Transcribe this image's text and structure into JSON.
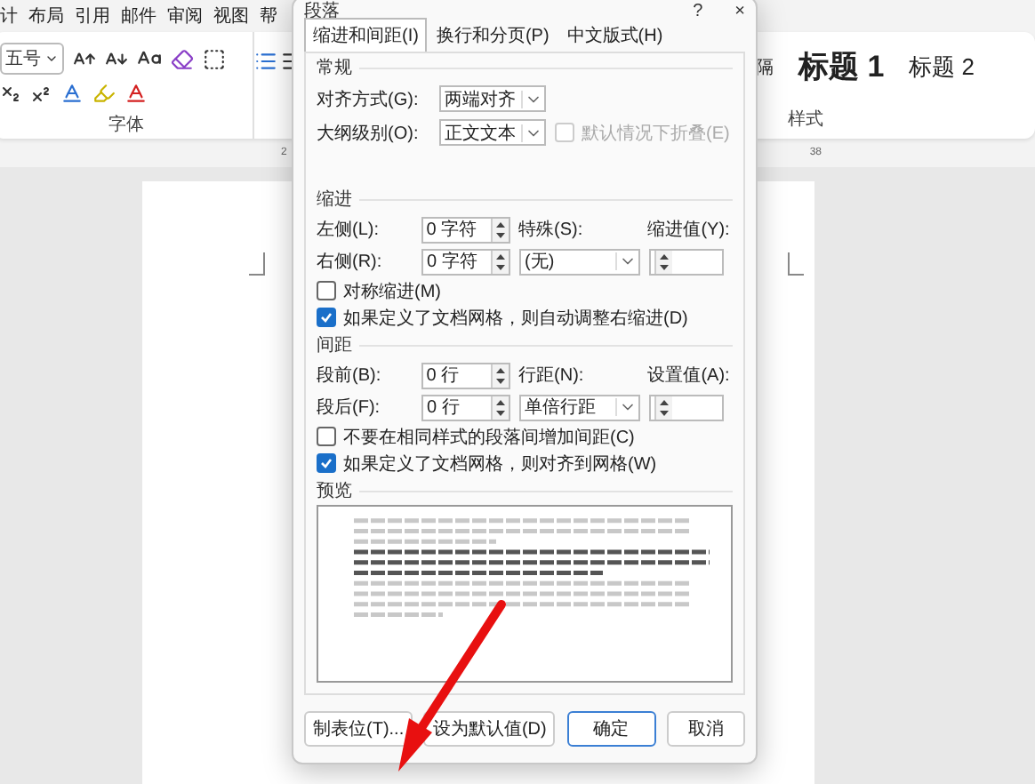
{
  "word": {
    "menu_tabs": [
      "计",
      "布局",
      "引用",
      "邮件",
      "审阅",
      "视图",
      "帮"
    ],
    "font_size": "五号",
    "font_group_label": "字体",
    "ruler_numbers": [
      "2",
      "38"
    ],
    "styles": [
      {
        "label": "隔",
        "kind": "normal"
      },
      {
        "label": "标题 1",
        "kind": "heading1"
      },
      {
        "label": "标题 2",
        "kind": "heading2"
      }
    ],
    "styles_group_label": "样式"
  },
  "dialog": {
    "title": "段落",
    "help": "?",
    "close": "×",
    "tabs": [
      {
        "label": "缩进和间距(I)",
        "selected": true
      },
      {
        "label": "换行和分页(P)",
        "selected": false
      },
      {
        "label": "中文版式(H)",
        "selected": false
      }
    ],
    "general": {
      "heading": "常规",
      "alignment": {
        "label": "对齐方式(G):",
        "value": "两端对齐"
      },
      "outline": {
        "label": "大纲级别(O):",
        "value": "正文文本"
      },
      "collapse": {
        "label": "默认情况下折叠(E)",
        "checked": false,
        "disabled": true
      }
    },
    "indent": {
      "heading": "缩进",
      "left": {
        "label": "左侧(L):",
        "value": "0 字符"
      },
      "right": {
        "label": "右侧(R):",
        "value": "0 字符"
      },
      "special": {
        "label": "特殊(S):",
        "value": "(无)"
      },
      "by": {
        "label": "缩进值(Y):"
      },
      "mirror": {
        "label": "对称缩进(M)",
        "checked": false
      },
      "auto_adjust": {
        "label": "如果定义了文档网格，则自动调整右缩进(D)",
        "checked": true
      }
    },
    "spacing": {
      "heading": "间距",
      "before": {
        "label": "段前(B):",
        "value": "0 行"
      },
      "after": {
        "label": "段后(F):",
        "value": "0 行"
      },
      "line": {
        "label": "行距(N):",
        "value": "单倍行距"
      },
      "at": {
        "label": "设置值(A):"
      },
      "no_space": {
        "label": "不要在相同样式的段落间增加间距(C)",
        "checked": false
      },
      "snap": {
        "label": "如果定义了文档网格，则对齐到网格(W)",
        "checked": true
      }
    },
    "preview": {
      "heading": "预览"
    },
    "buttons": [
      {
        "label": "制表位(T)...",
        "default": false
      },
      {
        "label": "设为默认值(D)",
        "default": false
      },
      {
        "label": "确定",
        "default": true
      },
      {
        "label": "取消",
        "default": false
      }
    ]
  }
}
